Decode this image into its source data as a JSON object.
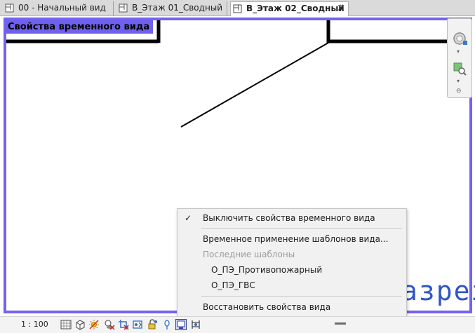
{
  "tabs": [
    {
      "label": "00 - Начальный вид",
      "active": false
    },
    {
      "label": "В_Этаж 01_Сводный",
      "active": false
    },
    {
      "label": "В_Этаж 02_Сводный",
      "active": true,
      "close": "✕"
    }
  ],
  "view": {
    "temp_label": "Свойства временного вида",
    "section_text": "азрез",
    "border_color": "#7462f3"
  },
  "navbar": {
    "caret": "▾",
    "minimize": "⊖"
  },
  "context_menu": {
    "items": [
      {
        "label": "Выключить свойства временного вида",
        "checked": true,
        "check": "✓"
      },
      {
        "label": "Временное применение шаблонов вида..."
      },
      {
        "label": "Последние шаблоны",
        "disabled": true
      },
      {
        "label": "О_ПЭ_Противопожарный"
      },
      {
        "label": "О_ПЭ_ГВС"
      },
      {
        "label": "Восстановить свойства вида"
      }
    ]
  },
  "statusbar": {
    "scale": "1 : 100",
    "icons": [
      "detail-level-icon",
      "visual-style-icon",
      "sun-path-icon",
      "shadows-icon",
      "crop-view-icon",
      "show-crop-icon",
      "unlocked-3d-icon",
      "temporary-hide-icon",
      "reveal-hidden-icon",
      "temporary-view-properties-icon",
      "hide-analytical-icon"
    ]
  }
}
